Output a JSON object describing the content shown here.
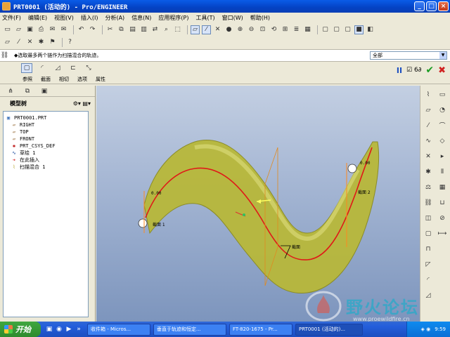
{
  "window": {
    "title": "PRT0001 (活动的) - Pro/ENGINEER",
    "min": "_",
    "max": "□",
    "close": "×"
  },
  "menu": [
    "文件(F)",
    "编辑(E)",
    "视图(V)",
    "插入(I)",
    "分析(A)",
    "信息(N)",
    "应用程序(P)",
    "工具(T)",
    "窗口(W)",
    "帮助(H)"
  ],
  "message": {
    "text": "◆选取最多两个链作为扫描混合的轨迹。",
    "filter_value": "全部"
  },
  "dashboard": {
    "tabs": [
      "参照",
      "截面",
      "相切",
      "选项",
      "属性"
    ],
    "pause": "II",
    "preview": "☑ 6∂",
    "ok": "✔",
    "cancel": "✖"
  },
  "model_tree": {
    "title": "模型树",
    "items": [
      {
        "label": "PRT0001.PRT",
        "icon": "part-icon",
        "indent": 0
      },
      {
        "label": "RIGHT",
        "icon": "datum-plane-icon",
        "indent": 1
      },
      {
        "label": "TOP",
        "icon": "datum-plane-icon",
        "indent": 1
      },
      {
        "label": "FRONT",
        "icon": "datum-plane-icon",
        "indent": 1
      },
      {
        "label": "PRT_CSYS_DEF",
        "icon": "csys-icon",
        "indent": 1
      },
      {
        "label": "草绘 1",
        "icon": "sketch-icon",
        "indent": 1
      },
      {
        "label": "在此插入",
        "icon": "insert-here-icon",
        "indent": 1
      },
      {
        "label": "扫描混合 1",
        "icon": "swept-blend-icon",
        "indent": 1
      }
    ]
  },
  "viewport": {
    "label_start": "0.00",
    "label_end": "0.00",
    "label_sec1": "截面 1",
    "label_sec2": "截面 2",
    "label_mid": "截面"
  },
  "taskbar": {
    "start": "开始",
    "tasks": [
      "收件箱 - Micros...",
      "垂直于轨迹和恒定...",
      "FT-820-1675 - Pr...",
      "PRT0001 (活动的)..."
    ],
    "clock": "9:59"
  },
  "watermark": {
    "text": "野火论坛",
    "url": "www.proewildfire.cn"
  },
  "colors": {
    "viewport_top": "#c3cfe2",
    "viewport_bottom": "#7d95bd",
    "surface": "#b8b83a",
    "trajectory": "#e01818"
  }
}
